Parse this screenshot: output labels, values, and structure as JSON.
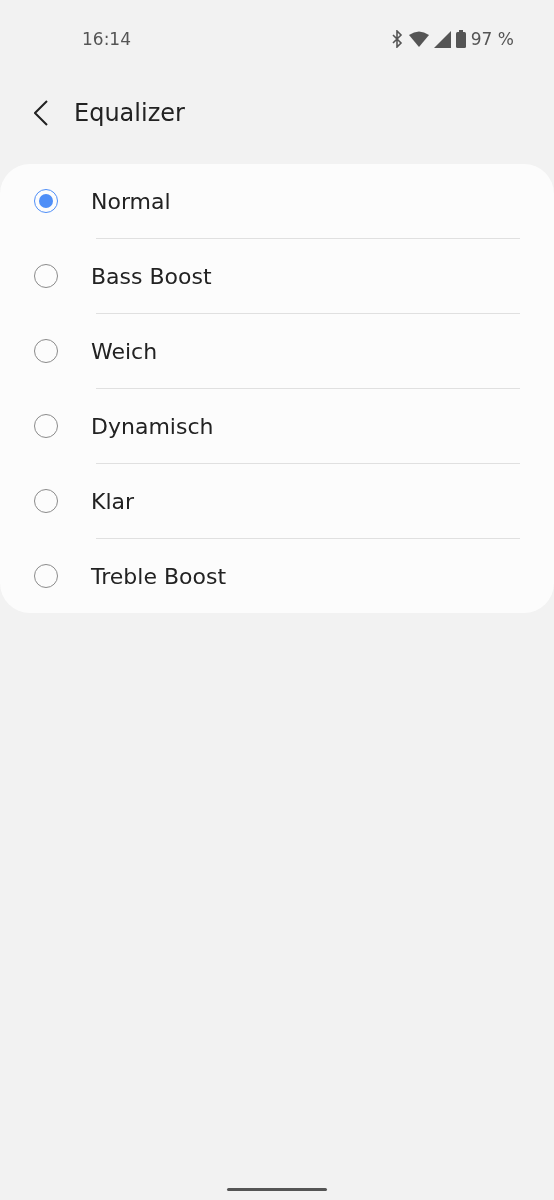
{
  "status_bar": {
    "time": "16:14",
    "battery": "97 %"
  },
  "header": {
    "title": "Equalizer"
  },
  "options": [
    {
      "label": "Normal",
      "selected": true
    },
    {
      "label": "Bass Boost",
      "selected": false
    },
    {
      "label": "Weich",
      "selected": false
    },
    {
      "label": "Dynamisch",
      "selected": false
    },
    {
      "label": "Klar",
      "selected": false
    },
    {
      "label": "Treble Boost",
      "selected": false
    }
  ]
}
